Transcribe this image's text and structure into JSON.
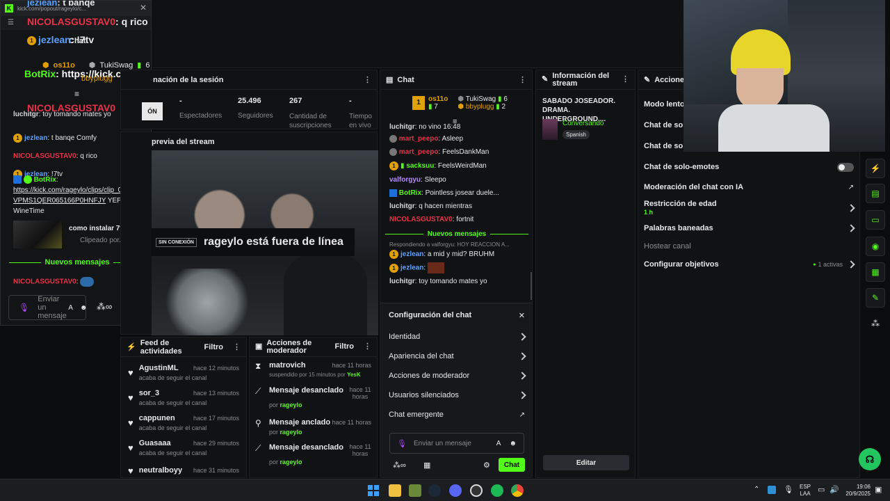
{
  "top_bar": {
    "text": ""
  },
  "popout": {
    "url": "kick.com/popout/rageylo/c...",
    "title": "Chat",
    "header_user": "jezlean",
    "header_msg": ": t banqe",
    "overlay_user": "NICOLASGUSTAV0",
    "overlay_msg": ": q rico",
    "overlay_user2": "jezlean",
    "overlay_msg2": ": !7tv",
    "overlay_bot": "BotRix",
    "overlay_bot_msg": ": https://kick.com/rageylo/clips/clip_01K3I",
    "gifters": [
      {
        "name": "os11o",
        "count": "7"
      },
      {
        "name": "TukiSwag",
        "count": "6"
      },
      {
        "name": "bbyplugg",
        "count": "2"
      }
    ],
    "messages": [
      {
        "user": "luchitgr",
        "text": ": toy tomando mates yo",
        "color": "#d9d9d9"
      },
      {
        "user": "NICOLASGUSTAV0",
        "text": ":",
        "color": "#e8334a"
      },
      {
        "user": "jezlean",
        "text": ": t banqe Comfy",
        "color": "#5aa2ff"
      },
      {
        "user": "NICOLASGUSTAV0",
        "text": ": q rico",
        "color": "#e8334a"
      },
      {
        "user": "jezlean",
        "text": ": !7tv",
        "color": "#5aa2ff"
      }
    ],
    "bot_user": "BotRix",
    "bot_link": "https://kick.com/rageylo/clips/clip_01K3HVPMS1QER065166P0HNFJY",
    "bot_tail": " YEP WineTime",
    "clip_title": "como instalar 7tv y...",
    "clip_sub": "Clipeado por...",
    "new_messages": "Nuevos mensajes",
    "last_user": "NICOLASGUSTAV0",
    "input_placeholder": "Enviar un mensaje"
  },
  "session": {
    "title": "nación de la sesión",
    "tab_label": "ÓN",
    "stats": [
      {
        "value": "-",
        "label": "Espectadores"
      },
      {
        "value": "25.496",
        "label": "Seguidores"
      },
      {
        "value": "267",
        "label": "Cantidad de suscripciones"
      },
      {
        "value": "-",
        "label": "Tiempo en vivo"
      }
    ]
  },
  "preview": {
    "title": "previa del stream",
    "offline_badge": "SIN CONEXIÓN",
    "offline_text": "rageylo está fuera de línea"
  },
  "chat": {
    "title": "Chat",
    "gifters": [
      {
        "name": "os11o",
        "count": "7"
      },
      {
        "name": "TukiSwag",
        "count": "6"
      },
      {
        "name": "bbyplugg",
        "count": "2"
      }
    ],
    "messages": [
      {
        "user": "luchitgr",
        "text": ": no vino 16:48",
        "color": "#d9d9d9"
      },
      {
        "user": "mart_peepo",
        "text": ": Asleep",
        "color": "#e8334a"
      },
      {
        "user": "mart_peepo",
        "text": ": FeelsDankMan",
        "color": "#e8334a"
      },
      {
        "user": "sacksuu",
        "text": ": FeelsWeirdMan",
        "color": "#53fc18"
      },
      {
        "user": "valforgyu",
        "text": ": Sleepo",
        "color": "#b58cff"
      },
      {
        "user": "BotRix",
        "text": ": Pointless josear duele...",
        "color": "#53fc18"
      },
      {
        "user": "luchitgr",
        "text": ": q hacen mientras",
        "color": "#d9d9d9"
      },
      {
        "user": "NICOLASGUSTAV0",
        "text": ": fortnit",
        "color": "#e8334a"
      }
    ],
    "new_messages": "Nuevos mensajes",
    "reply_note": "Respondiendo a valforgyu: HOY REACCION A...",
    "after": [
      {
        "user": "jezlean",
        "text": ": a mid y mid? BRUHM",
        "color": "#5aa2ff"
      },
      {
        "user": "jezlean",
        "text": ":",
        "color": "#5aa2ff"
      },
      {
        "user": "luchitgr",
        "text": ": toy tomando mates yo",
        "color": "#d9d9d9"
      },
      {
        "user": "jezlean",
        "text": ": t banqe",
        "color": "#5aa2ff"
      }
    ]
  },
  "chat_settings": {
    "title": "Configuración del chat",
    "items": [
      "Identidad",
      "Apariencia del chat",
      "Acciones de moderador",
      "Usuarios silenciados",
      "Chat emergente"
    ],
    "input_placeholder": "Enviar un mensaje",
    "send_label": "Chat"
  },
  "stream_info": {
    "title": "Información del stream",
    "stream_title": "SABADO JOSEADOR. DRAMA. UNDERGROUND....",
    "category": "Conversando",
    "language": "Spanish",
    "edit_label": "Editar"
  },
  "actions": {
    "title": "Acciones",
    "items": [
      {
        "label": "Modo lento",
        "sub": ""
      },
      {
        "label": "Chat de solo-",
        "sub": ""
      },
      {
        "label": "Chat de solo-",
        "sub": ""
      },
      {
        "label": "Chat de solo-emotes",
        "sub": ""
      },
      {
        "label": "Moderación del chat con IA",
        "sub": ""
      },
      {
        "label": "Restricción de edad",
        "sub": "1 h"
      },
      {
        "label": "Palabras baneadas",
        "sub": ""
      },
      {
        "label": "Hostear canal",
        "sub": ""
      },
      {
        "label": "Configurar objetivos",
        "sub": ""
      }
    ],
    "goals_active": "1 activas"
  },
  "activity": {
    "title": "Feed de actividades",
    "filter": "Filtro",
    "items": [
      {
        "user": "AgustinML",
        "time": "hace 12 minutos",
        "desc": "acaba de seguir el canal"
      },
      {
        "user": "sor_3",
        "time": "hace 13 minutos",
        "desc": "acaba de seguir el canal"
      },
      {
        "user": "cappunen",
        "time": "hace 17 minutos",
        "desc": "acaba de seguir el canal"
      },
      {
        "user": "Guasaaa",
        "time": "hace 29 minutos",
        "desc": "acaba de seguir el canal"
      },
      {
        "user": "neutralboyy",
        "time": "hace 31 minutos",
        "desc": ""
      }
    ]
  },
  "mod_actions": {
    "title": "Acciones de moderador",
    "filter": "Filtro",
    "items": [
      {
        "title": "matrovich",
        "time": "hace 11 horas",
        "desc": "suspendido por 15 minutos por ",
        "by": "YesK"
      },
      {
        "title": "Mensaje desanclado",
        "time": "hace 11 horas",
        "desc": "por ",
        "by": "rageylo"
      },
      {
        "title": "Mensaje anclado",
        "time": "hace 11 horas",
        "desc": "por ",
        "by": "rageylo"
      },
      {
        "title": "Mensaje desanclado",
        "time": "hace 11 horas",
        "desc": "por ",
        "by": "rageylo"
      }
    ]
  },
  "taskbar": {
    "lang": "ESP",
    "region": "LAA",
    "time": "19:06",
    "date": "20/9/2025"
  },
  "colors": {
    "accent": "#53fc18",
    "bg": "#0b0c0e",
    "panel": "#111214"
  }
}
